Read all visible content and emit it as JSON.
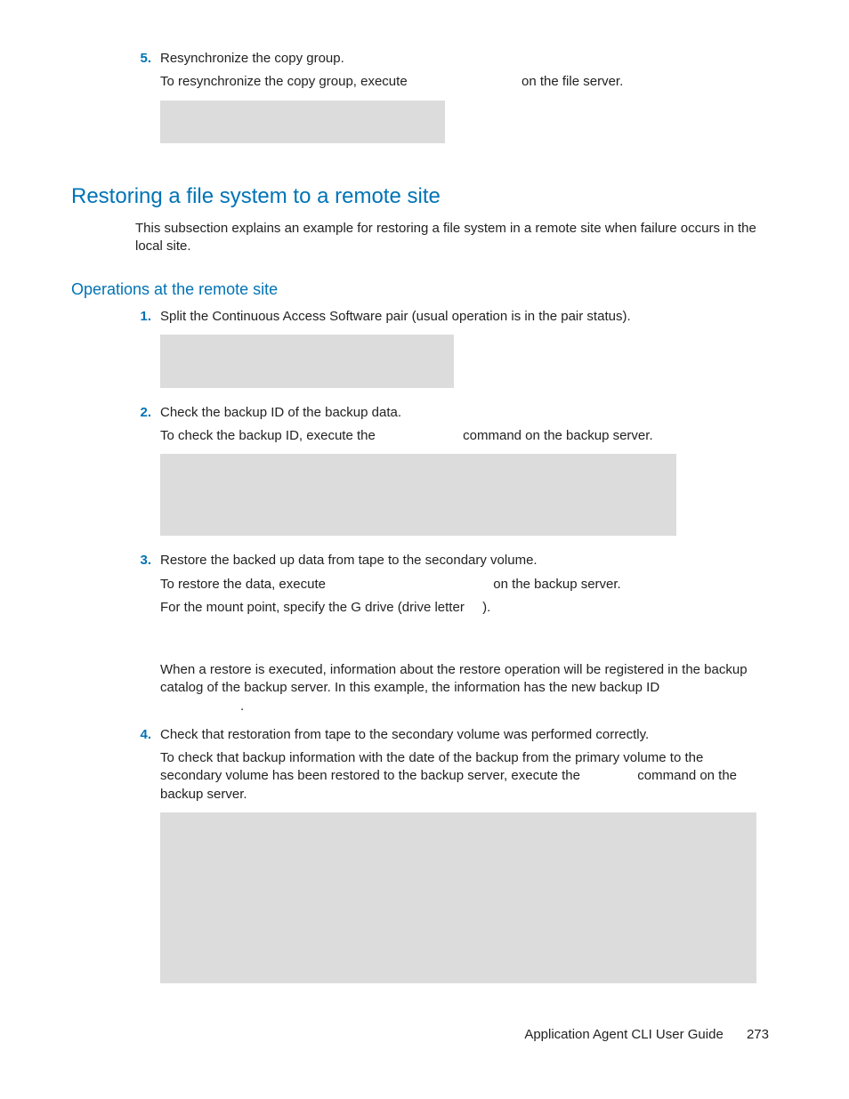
{
  "step5": {
    "num": "5.",
    "title": "Resynchronize the copy group.",
    "line_a": "To resynchronize the copy group, execute",
    "line_b": "on the file server."
  },
  "heading1": "Restoring a file system to a remote site",
  "intro1": "This subsection explains an example for restoring a file system in a remote site when failure occurs in the local site.",
  "heading2": "Operations at the remote site",
  "step1": {
    "num": "1.",
    "title": "Split the Continuous Access Software pair (usual operation is in the pair status)."
  },
  "step2": {
    "num": "2.",
    "title": "Check the backup ID of the backup data.",
    "line_a": "To check the backup ID, execute the",
    "line_b": "command on the backup server."
  },
  "step3": {
    "num": "3.",
    "title": "Restore the backed up data from tape to the secondary volume.",
    "line_a": "To restore the data, execute",
    "line_b": "on the backup server.",
    "line2_a": "For the mount point, specify the G drive (drive letter",
    "line2_b": ").",
    "post_a": "When a restore is executed, information about the restore operation will be registered in the backup catalog of the backup server. In this example, the information has the new backup ID",
    "post_b": "."
  },
  "step4": {
    "num": "4.",
    "title": "Check that restoration from tape to the secondary volume was performed correctly.",
    "line_a": "To check that backup information with the date of the backup from the primary volume to the secondary volume has been restored to the backup server, execute the",
    "line_b": "command on the backup server."
  },
  "footer": {
    "title": "Application Agent CLI User Guide",
    "page": "273"
  }
}
